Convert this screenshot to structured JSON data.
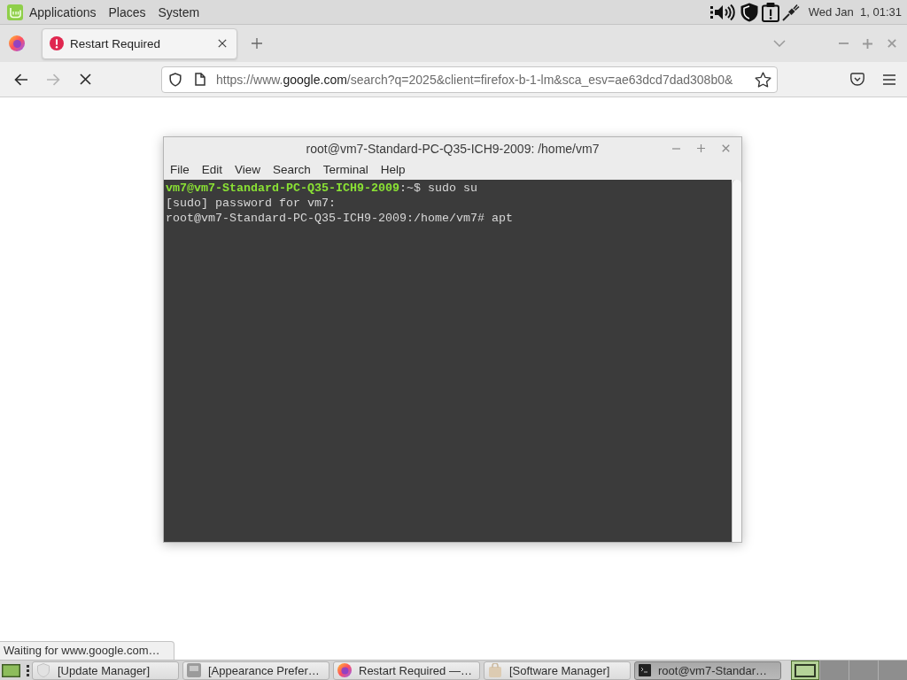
{
  "top_panel": {
    "menus": [
      "Applications",
      "Places",
      "System"
    ],
    "clock": "Wed Jan  1, 01:31"
  },
  "browser": {
    "tabs": [
      {
        "label": "Restart Required",
        "selected": true
      }
    ],
    "nav_buttons": [
      {
        "kind": "back",
        "disabled": false
      },
      {
        "kind": "forward",
        "disabled": true
      },
      {
        "kind": "stop",
        "disabled": false
      }
    ],
    "url": {
      "before": "https://www.",
      "domain": "google.com",
      "after": "/search?q=2025&client=firefox-b-1-lm&sca_esv=ae63dcd7dad308b0&"
    },
    "status": "Waiting for www.google.com…"
  },
  "terminal": {
    "title": "root@vm7-Standard-PC-Q35-ICH9-2009: /home/vm7",
    "menu": [
      "File",
      "Edit",
      "View",
      "Search",
      "Terminal",
      "Help"
    ],
    "lines": [
      {
        "kind": "prompt",
        "user_host": "vm7@vm7-Standard-PC-Q35-ICH9-2009",
        "text": ":~$ sudo su"
      },
      {
        "kind": "plain",
        "text": "[sudo] password for vm7:"
      },
      {
        "kind": "plain",
        "text": "root@vm7-Standard-PC-Q35-ICH9-2009:/home/vm7# apt"
      }
    ]
  },
  "taskbar": {
    "items": [
      {
        "label": "[Update Manager]",
        "selected": false
      },
      {
        "label": "[Appearance Prefer…",
        "selected": false
      },
      {
        "label": "Restart Required —…",
        "selected": false
      },
      {
        "label": "[Software Manager]",
        "selected": false
      },
      {
        "label": "root@vm7-Standar…",
        "selected": true
      }
    ],
    "workspaces": [
      {
        "selected": true
      },
      {
        "selected": false
      },
      {
        "selected": false
      },
      {
        "selected": false
      }
    ]
  }
}
